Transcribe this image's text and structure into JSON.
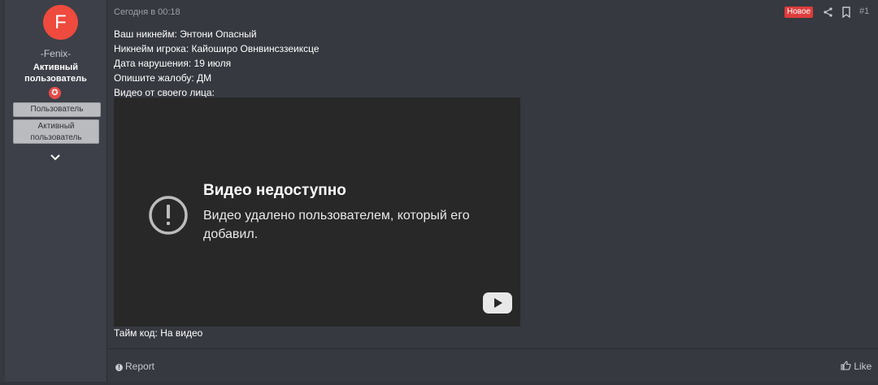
{
  "user": {
    "avatar_letter": "F",
    "name": "-Fenix-",
    "title_line1": "Активный",
    "title_line2": "пользователь",
    "banners": [
      "Пользователь",
      "Активный",
      "пользователь"
    ]
  },
  "post": {
    "date": "Сегодня в 00:18",
    "new_badge": "Новое",
    "number": "#1",
    "lines": [
      "Ваш никнейм: Энтони Опасный",
      "Никнейм игрока: Кайоширо Овнвинсззеиксце",
      "Дата нарушения: 19 июля",
      "Опишите жалобу: ДМ",
      "Видео от своего лица:"
    ],
    "video": {
      "title": "Видео недоступно",
      "message": "Видео удалено пользователем, который его добавил."
    },
    "timecode": "Тайм код: На видео"
  },
  "footer": {
    "report": "Report",
    "like": "Like"
  },
  "colors": {
    "accent": "#ef4a3e",
    "new_badge": "#dd3c3c"
  }
}
